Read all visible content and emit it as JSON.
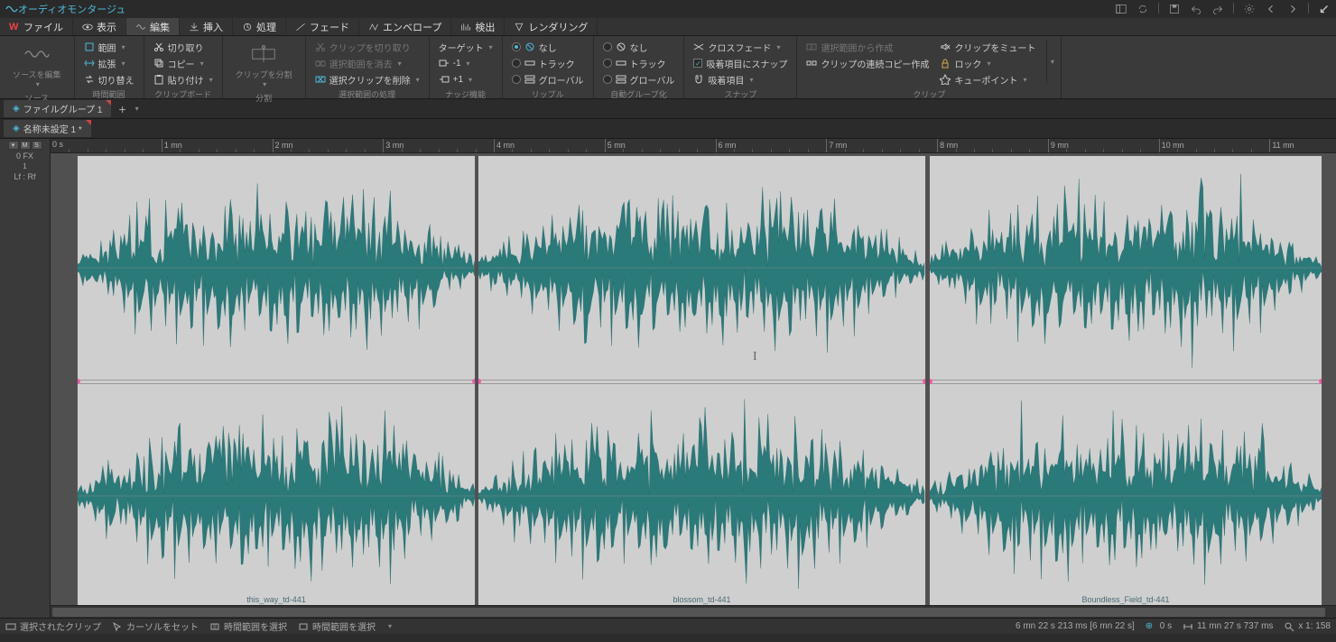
{
  "title": "オーディオモンタージュ",
  "menu": {
    "file": "ファイル",
    "view": "表示",
    "edit": "編集",
    "insert": "挿入",
    "process": "処理",
    "fade": "フェード",
    "envelope": "エンベロープ",
    "detect": "検出",
    "render": "レンダリング"
  },
  "ribbon": {
    "source": {
      "editSource": "ソースを編集",
      "label": "ソース"
    },
    "timeSel": {
      "range": "範囲",
      "extend": "拡張",
      "swap": "切り替え",
      "label": "時間範囲"
    },
    "clipboard": {
      "cut": "切り取り",
      "copy": "コピー",
      "paste": "貼り付け",
      "label": "クリップボード"
    },
    "split": {
      "splitClip": "クリップを分割",
      "label": "分割"
    },
    "selection": {
      "cutClip": "クリップを切り取り",
      "delRange": "選択範囲を消去",
      "delSelClip": "選択クリップを削除",
      "label": "選択範囲の処理"
    },
    "nudge": {
      "target": "ターゲット",
      "minus1": "-1",
      "plus1": "+1",
      "label": "ナッジ機能"
    },
    "ripple": {
      "none": "なし",
      "track": "トラック",
      "global": "グローバル",
      "label": "リップル"
    },
    "autogroup": {
      "none": "なし",
      "track": "トラック",
      "global": "グローバル",
      "label": "自動グループ化"
    },
    "snap": {
      "crossfade": "クロスフェード",
      "snapToMagnet": "吸着項目にスナップ",
      "magnets": "吸着項目",
      "label": "スナップ"
    },
    "clip": {
      "fromSel": "選択範囲から作成",
      "chainCopy": "クリップの連続コピー作成",
      "mute": "クリップをミュート",
      "lock": "ロック",
      "cuepoint": "キューポイント",
      "label": "クリップ"
    }
  },
  "fileGroupTab": "ファイルグループ 1",
  "fileTab": "名称未設定 1 *",
  "trackHeader": {
    "fx": "0 FX",
    "channels": "Lf : Rf",
    "btns": [
      "▾",
      "M",
      "S"
    ]
  },
  "ruler": {
    "start": "0 s",
    "marks": [
      "1 mn",
      "2 mn",
      "3 mn",
      "4 mn",
      "5 mn",
      "6 mn",
      "7 mn",
      "8 mn",
      "9 mn",
      "10 mn",
      "11 mn"
    ]
  },
  "clips": [
    {
      "name": "this_way_td-441",
      "startPx": 29,
      "widthPx": 442
    },
    {
      "name": "blossom_td-441",
      "startPx": 473,
      "widthPx": 497
    },
    {
      "name": "Boundless_Field_td-441",
      "startPx": 973,
      "widthPx": 436
    }
  ],
  "status": {
    "selClip": "選択されたクリップ",
    "setCursor": "カーソルをセット",
    "selRange": "時間範囲を選択",
    "selRange2": "時間範囲を選択",
    "pos": "6 mn 22 s 213 ms [6 mn 22 s]",
    "posIcon": "0 s",
    "total": "11 mn 27 s 737 ms",
    "zoom": "x 1: 158"
  }
}
